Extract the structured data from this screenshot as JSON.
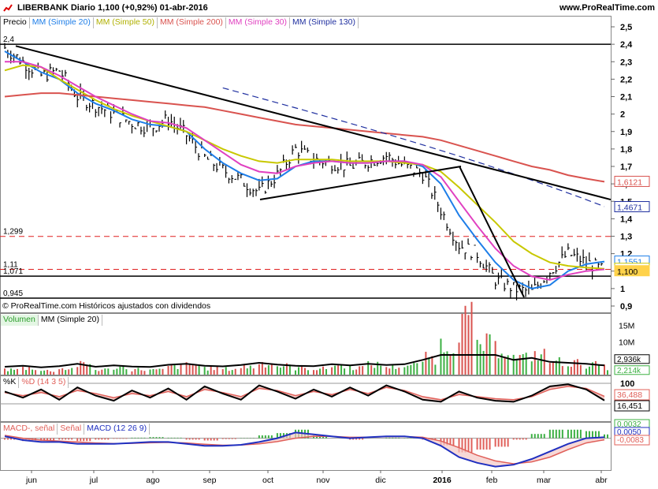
{
  "header": {
    "title": "LIBERBANK  Diario  1,100 (+0,92%)  01-abr-2016",
    "site": "www.ProRealTime.com",
    "credit": "© ProRealTime.com Históricos ajustados con dividendos"
  },
  "legends": {
    "price": [
      "Precio",
      "MM (Simple 20)",
      "MM (Simple 50)",
      "MM (Simple 200)",
      "MM (Simple 30)",
      "MM (Simple 130)"
    ],
    "volume": [
      "Volumen",
      "MM (Simple 20)"
    ],
    "stoch": [
      "%K",
      "%D (14 3 5)"
    ],
    "macd": [
      "MACD-, señal",
      "Señal",
      "MACD (12 26 9)"
    ]
  },
  "colors": {
    "ma20": "#1e7ee8",
    "ma50": "#c8c800",
    "ma200": "#d9534f",
    "ma30": "#e040c0",
    "ma130": "#2030a0",
    "last": "#ffd24a",
    "hline_red": "#e02020"
  },
  "chart_data": [
    {
      "type": "line",
      "title": "LIBERBANK Diario",
      "x": [
        "jun",
        "jul",
        "ago",
        "sep",
        "oct",
        "nov",
        "dic",
        "2016",
        "feb",
        "mar",
        "abr"
      ],
      "ylim": [
        0.9,
        2.5
      ],
      "yticks": [
        "2,5",
        "2,4",
        "2,3",
        "2,2",
        "2,1",
        "2",
        "1,9",
        "1,8",
        "1,7",
        "1,6",
        "1,5",
        "1,4",
        "1,3",
        "1,2",
        "1,1",
        "1",
        "0,9"
      ],
      "levels": [
        {
          "label": "2,4",
          "value": 2.4,
          "style": "solid"
        },
        {
          "label": "1,299",
          "value": 1.299,
          "style": "dashed"
        },
        {
          "label": "1,11",
          "value": 1.11,
          "style": "dashed"
        },
        {
          "label": "1,071",
          "value": 1.071,
          "style": "solid"
        },
        {
          "label": "0,945",
          "value": 0.945,
          "style": "solid"
        }
      ],
      "last_labels": [
        {
          "label": "1,6121",
          "color": "#d9534f"
        },
        {
          "label": "1,4671",
          "color": "#2030a0"
        },
        {
          "label": "1,1551",
          "color": "#1e7ee8"
        },
        {
          "label": "1,1135",
          "color": "#c8c800"
        },
        {
          "label": "1,100",
          "color": "#ffd24a"
        }
      ],
      "series": [
        {
          "name": "Precio",
          "values": [
            2.38,
            2.3,
            2.22,
            2.25,
            2.1,
            2.05,
            2.0,
            1.95,
            1.92,
            1.97,
            1.88,
            1.75,
            1.68,
            1.62,
            1.55,
            1.65,
            1.8,
            1.74,
            1.72,
            1.7,
            1.73,
            1.76,
            1.7,
            1.66,
            1.45,
            1.25,
            1.2,
            1.05,
            1.0,
            0.98,
            1.1,
            1.2,
            1.15,
            1.1
          ]
        },
        {
          "name": "MM (Simple 20)",
          "values": [
            2.36,
            2.3,
            2.24,
            2.2,
            2.12,
            2.06,
            2.02,
            1.97,
            1.94,
            1.93,
            1.9,
            1.8,
            1.72,
            1.66,
            1.62,
            1.63,
            1.7,
            1.73,
            1.73,
            1.72,
            1.72,
            1.73,
            1.73,
            1.7,
            1.6,
            1.42,
            1.28,
            1.15,
            1.05,
            1.0,
            1.02,
            1.1,
            1.14,
            1.155
          ]
        },
        {
          "name": "MM (Simple 50)",
          "values": [
            2.25,
            2.28,
            2.27,
            2.2,
            2.14,
            2.08,
            2.03,
            1.99,
            1.96,
            1.93,
            1.9,
            1.85,
            1.8,
            1.76,
            1.73,
            1.72,
            1.74,
            1.74,
            1.74,
            1.73,
            1.73,
            1.73,
            1.72,
            1.71,
            1.67,
            1.58,
            1.48,
            1.38,
            1.27,
            1.2,
            1.15,
            1.13,
            1.12,
            1.1135
          ]
        },
        {
          "name": "MM (Simple 200)",
          "values": [
            2.1,
            2.11,
            2.12,
            2.12,
            2.11,
            2.1,
            2.09,
            2.08,
            2.07,
            2.06,
            2.05,
            2.04,
            2.02,
            2.0,
            1.98,
            1.96,
            1.94,
            1.93,
            1.92,
            1.91,
            1.9,
            1.89,
            1.88,
            1.87,
            1.85,
            1.82,
            1.79,
            1.76,
            1.73,
            1.7,
            1.68,
            1.65,
            1.63,
            1.6121
          ]
        },
        {
          "name": "MM (Simple 30)",
          "values": [
            2.3,
            2.3,
            2.27,
            2.22,
            2.16,
            2.1,
            2.05,
            2.0,
            1.96,
            1.95,
            1.92,
            1.85,
            1.78,
            1.71,
            1.67,
            1.66,
            1.7,
            1.72,
            1.73,
            1.72,
            1.72,
            1.73,
            1.73,
            1.71,
            1.64,
            1.5,
            1.36,
            1.23,
            1.13,
            1.07,
            1.05,
            1.08,
            1.1,
            1.11
          ]
        }
      ]
    },
    {
      "type": "bar",
      "title": "Volumen",
      "yticks": [
        "15M",
        "10M",
        "5M"
      ],
      "last_labels": [
        "2,936k",
        "2,214k"
      ],
      "values": [
        1.5,
        2,
        1.2,
        1.8,
        3,
        1.5,
        2.2,
        1.6,
        1.4,
        2.5,
        3,
        2,
        1.7,
        2.4,
        3.5,
        2.6,
        2,
        1.8,
        2.8,
        2.2,
        3,
        2.4,
        2.8,
        5,
        9,
        16,
        9,
        8,
        5,
        6,
        4,
        3.5,
        3,
        2.2
      ]
    },
    {
      "type": "line",
      "title": "%K %D (14 3 5)",
      "yticks": [
        "100"
      ],
      "last_labels": [
        "36,488",
        "16,451"
      ],
      "series": [
        {
          "name": "%K",
          "values": [
            60,
            30,
            70,
            20,
            80,
            40,
            15,
            65,
            30,
            75,
            20,
            85,
            50,
            20,
            90,
            60,
            25,
            70,
            35,
            80,
            40,
            90,
            60,
            20,
            10,
            60,
            30,
            15,
            10,
            40,
            85,
            95,
            70,
            16.451
          ]
        },
        {
          "name": "%D (14 3 5)",
          "values": [
            55,
            40,
            55,
            35,
            65,
            50,
            30,
            50,
            40,
            60,
            35,
            70,
            55,
            35,
            75,
            65,
            40,
            60,
            45,
            70,
            50,
            80,
            65,
            35,
            20,
            45,
            35,
            25,
            20,
            35,
            70,
            85,
            75,
            36.488
          ]
        }
      ]
    },
    {
      "type": "line",
      "title": "MACD (12 26 9)",
      "last_labels": [
        "0,0032",
        "0,0050",
        "-0,0083"
      ],
      "series": [
        {
          "name": "MACD (12 26 9)",
          "values": [
            0.01,
            -0.01,
            -0.02,
            -0.02,
            -0.03,
            -0.03,
            -0.03,
            -0.025,
            -0.02,
            -0.02,
            -0.03,
            -0.04,
            -0.04,
            -0.035,
            -0.02,
            0.0,
            0.03,
            0.02,
            0.01,
            0.0,
            0.005,
            0.01,
            0.01,
            0.0,
            -0.04,
            -0.1,
            -0.13,
            -0.15,
            -0.14,
            -0.11,
            -0.07,
            -0.03,
            0.0,
            0.005
          ]
        },
        {
          "name": "Señal",
          "values": [
            0.015,
            0.0,
            -0.01,
            -0.015,
            -0.02,
            -0.025,
            -0.028,
            -0.027,
            -0.024,
            -0.022,
            -0.025,
            -0.032,
            -0.037,
            -0.036,
            -0.03,
            -0.018,
            0.0,
            0.01,
            0.01,
            0.005,
            0.005,
            0.008,
            0.009,
            0.005,
            -0.015,
            -0.05,
            -0.09,
            -0.12,
            -0.135,
            -0.125,
            -0.1,
            -0.06,
            -0.025,
            -0.0083
          ]
        }
      ]
    }
  ]
}
